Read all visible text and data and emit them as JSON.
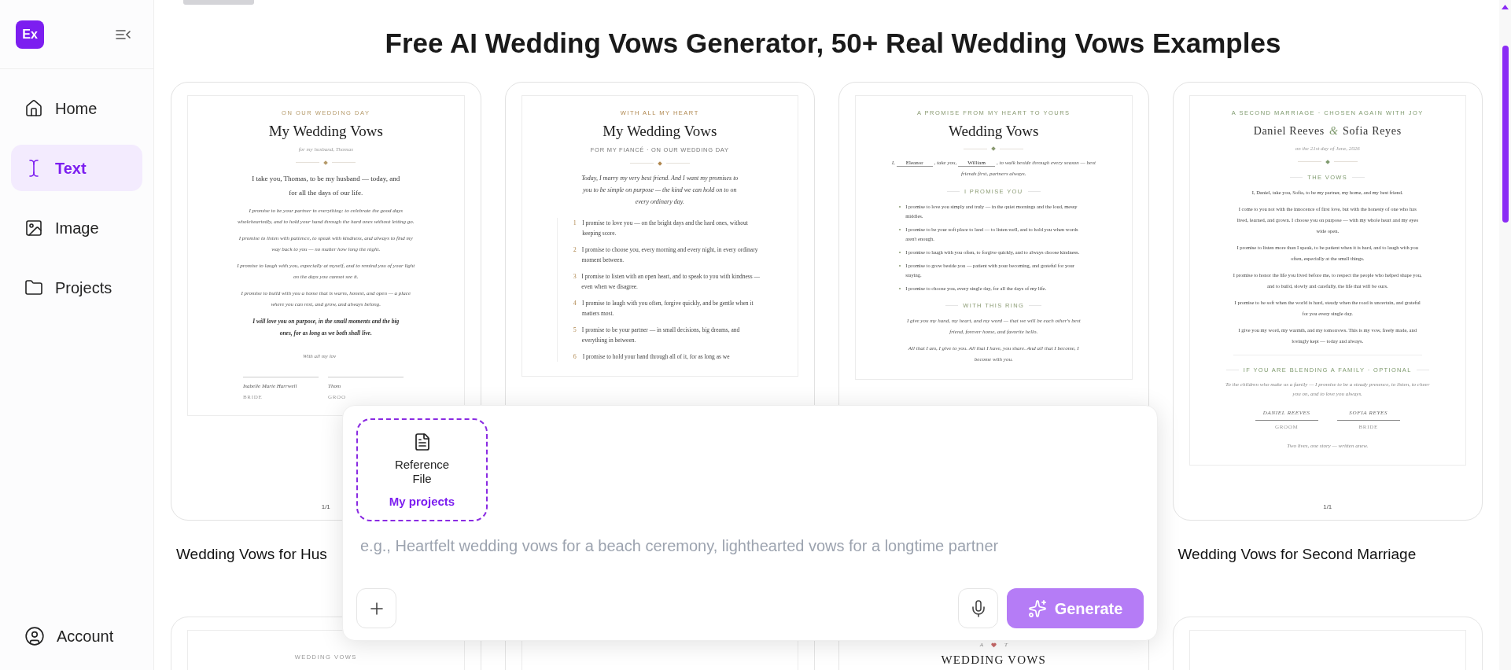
{
  "sidebar": {
    "logo": "Ex",
    "nav": [
      {
        "label": "Home",
        "selected": false
      },
      {
        "label": "Text",
        "selected": true
      },
      {
        "label": "Image",
        "selected": false
      },
      {
        "label": "Projects",
        "selected": false
      }
    ],
    "account": "Account"
  },
  "page_title": "Free AI Wedding Vows Generator, 50+ Real Wedding Vows Examples",
  "examples": [
    {
      "title": "Wedding Vows for Hus",
      "page_number": "1/1",
      "document": {
        "color": "#b59a6a",
        "blocks": [
          {
            "kind": "eyebrow",
            "text": "ON OUR WEDDING DAY"
          },
          {
            "kind": "title",
            "text": "My Wedding Vows"
          },
          {
            "kind": "subtitle",
            "text": "for my husband, Thomas"
          },
          {
            "kind": "ornament"
          },
          {
            "kind": "lead",
            "text": "I take you, Thomas, to be my husband — today, and for all the days of our life."
          },
          {
            "kind": "italic",
            "text": "I promise to be your partner in everything: to celebrate the good days wholeheartedly, and to hold your hand through the hard ones without letting go."
          },
          {
            "kind": "italic",
            "text": "I promise to listen with patience, to speak with kindness, and always to find my way back to you — no matter how long the night."
          },
          {
            "kind": "italic",
            "text": "I promise to laugh with you, especially at myself, and to remind you of your light on the days you cannot see it."
          },
          {
            "kind": "italic",
            "text": "I promise to build with you a home that is warm, honest, and open — a place where you can rest, and grow, and always belong."
          },
          {
            "kind": "emphasis",
            "text": "I will love you on purpose, in the small moments and the big ones, for as long as we both shall live."
          },
          {
            "kind": "closing",
            "text": "With all my lov"
          },
          {
            "kind": "signatures",
            "items": [
              {
                "name": "Isabelle Marie Harrwell",
                "role": "BRIDE"
              },
              {
                "name": "Thom",
                "role": "GROO"
              }
            ]
          }
        ]
      }
    },
    {
      "document": {
        "color": "#b08850",
        "blocks": [
          {
            "kind": "eyebrow",
            "text": "WITH ALL MY HEART"
          },
          {
            "kind": "title",
            "text": "My Wedding Vows"
          },
          {
            "kind": "caption",
            "text": "FOR MY FIANCÉ · ON OUR WEDDING DAY"
          },
          {
            "kind": "ornament"
          },
          {
            "kind": "intro",
            "text": "Today, I marry my very best friend. And I want my promises to you to be simple on purpose — the kind we can hold on to on every ordinary day."
          },
          {
            "kind": "numbered",
            "items": [
              {
                "number": "1",
                "text": "I promise to love you — on the bright days and the hard ones, without keeping score."
              },
              {
                "number": "2",
                "text": "I promise to choose you, every morning and every night, in every ordinary moment between."
              },
              {
                "number": "3",
                "text": "I promise to listen with an open heart, and to speak to you with kindness — even when we disagree."
              },
              {
                "number": "4",
                "text": "I promise to laugh with you often, forgive quickly, and be gentle when it matters most."
              },
              {
                "number": "5",
                "text": "I promise to be your partner — in small decisions, big dreams, and everything in between."
              },
              {
                "number": "6",
                "text": "I promise to hold your hand through all of it, for as long as we"
              }
            ]
          }
        ]
      }
    },
    {
      "document": {
        "color": "#8a9a72",
        "blocks": [
          {
            "kind": "eyebrow",
            "text": "A PROMISE FROM MY HEART TO YOURS"
          },
          {
            "kind": "title",
            "text": "Wedding Vows"
          },
          {
            "kind": "ornament"
          },
          {
            "kind": "fill-in",
            "parts": [
              {
                "kind": "text",
                "text": "I,"
              },
              {
                "kind": "blank",
                "text": "Eleanor"
              },
              {
                "kind": "text",
                "text": ", take you,"
              },
              {
                "kind": "blank",
                "text": "William"
              },
              {
                "kind": "text",
                "text": ", to walk beside through every season — best friends first, partners always."
              }
            ]
          },
          {
            "kind": "section",
            "text": "I PROMISE YOU"
          },
          {
            "kind": "bullets",
            "items": [
              "I promise to love you simply and truly — in the quiet mornings and the loud, messy middles.",
              "I promise to be your soft place to land — to listen well, and to hold you when words aren't enough.",
              "I promise to laugh with you often, to forgive quickly, and to always choose kindness.",
              "I promise to grow beside you — patient with your becoming, and grateful for your staying.",
              "I promise to choose you, every single day, for all the days of my life."
            ]
          },
          {
            "kind": "section",
            "text": "WITH THIS RING"
          },
          {
            "kind": "italic",
            "text": "I give you my hand, my heart, and my word — that we will be each other's best friend, forever home, and favorite hello."
          },
          {
            "kind": "italic",
            "text": "All that I am, I give to you. All that I have, you share. And all that I become, I become with you."
          }
        ]
      }
    },
    {
      "title": "Wedding Vows for Second Marriage",
      "page_number": "1/1",
      "document": {
        "color": "#7f9a6e",
        "blocks": [
          {
            "kind": "eyebrow",
            "text": "A SECOND MARRIAGE · CHOSEN AGAIN WITH JOY"
          },
          {
            "kind": "names",
            "parts": [
              "Daniel Reeves",
              "&",
              "Sofia Reyes"
            ]
          },
          {
            "kind": "subtitle",
            "text": "on the 21st day of June, 2026"
          },
          {
            "kind": "ornament"
          },
          {
            "kind": "section",
            "text": "THE VOWS"
          },
          {
            "kind": "para",
            "text": "I, Daniel, take you, Sofia, to be my partner, my home, and my best friend."
          },
          {
            "kind": "para",
            "text": "I come to you not with the innocence of first love, but with the honesty of one who has lived, learned, and grown. I choose you on purpose — with my whole heart and my eyes wide open."
          },
          {
            "kind": "para",
            "text": "I promise to listen more than I speak, to be patient when it is hard, and to laugh with you often, especially at the small things."
          },
          {
            "kind": "para",
            "text": "I promise to honor the life you lived before me, to respect the people who helped shape you, and to build, slowly and carefully, the life that will be ours."
          },
          {
            "kind": "para",
            "text": "I promise to be soft when the world is hard, steady when the road is uncertain, and grateful for you every single day."
          },
          {
            "kind": "para",
            "text": "I give you my word, my warmth, and my tomorrows. This is my vow, freely made, and lovingly kept — today and always."
          },
          {
            "kind": "rule"
          },
          {
            "kind": "section",
            "text": "IF YOU ARE BLENDING A FAMILY · OPTIONAL"
          },
          {
            "kind": "note",
            "text": "To the children who make us a family — I promise to be a steady presence, to listen, to cheer you on, and to love you always."
          },
          {
            "kind": "signature-lines",
            "items": [
              {
                "name": "DANIEL REEVES",
                "role": "GROOM"
              },
              {
                "name": "SOFIA REYES",
                "role": "BRIDE"
              }
            ]
          },
          {
            "kind": "note",
            "text": "Two lives, one story — written anew."
          }
        ]
      }
    }
  ],
  "more_examples": [
    {
      "kind": "page",
      "blocks": [
        {
          "kind": "eyebrow",
          "text": "WEDDING VOWS"
        }
      ]
    },
    {
      "kind": "page"
    },
    {
      "kind": "open",
      "blocks": [
        {
          "kind": "monogram",
          "parts": [
            "A",
            "T"
          ]
        },
        {
          "kind": "heading",
          "text": "WEDDING VOWS"
        }
      ]
    },
    {
      "kind": "page"
    }
  ],
  "composer": {
    "reference": {
      "label": "Reference File",
      "link": "My projects"
    },
    "placeholder": "e.g., Heartfelt wedding vows for a beach ceremony, lighthearted vows for a longtime partner",
    "generate": "Generate"
  }
}
